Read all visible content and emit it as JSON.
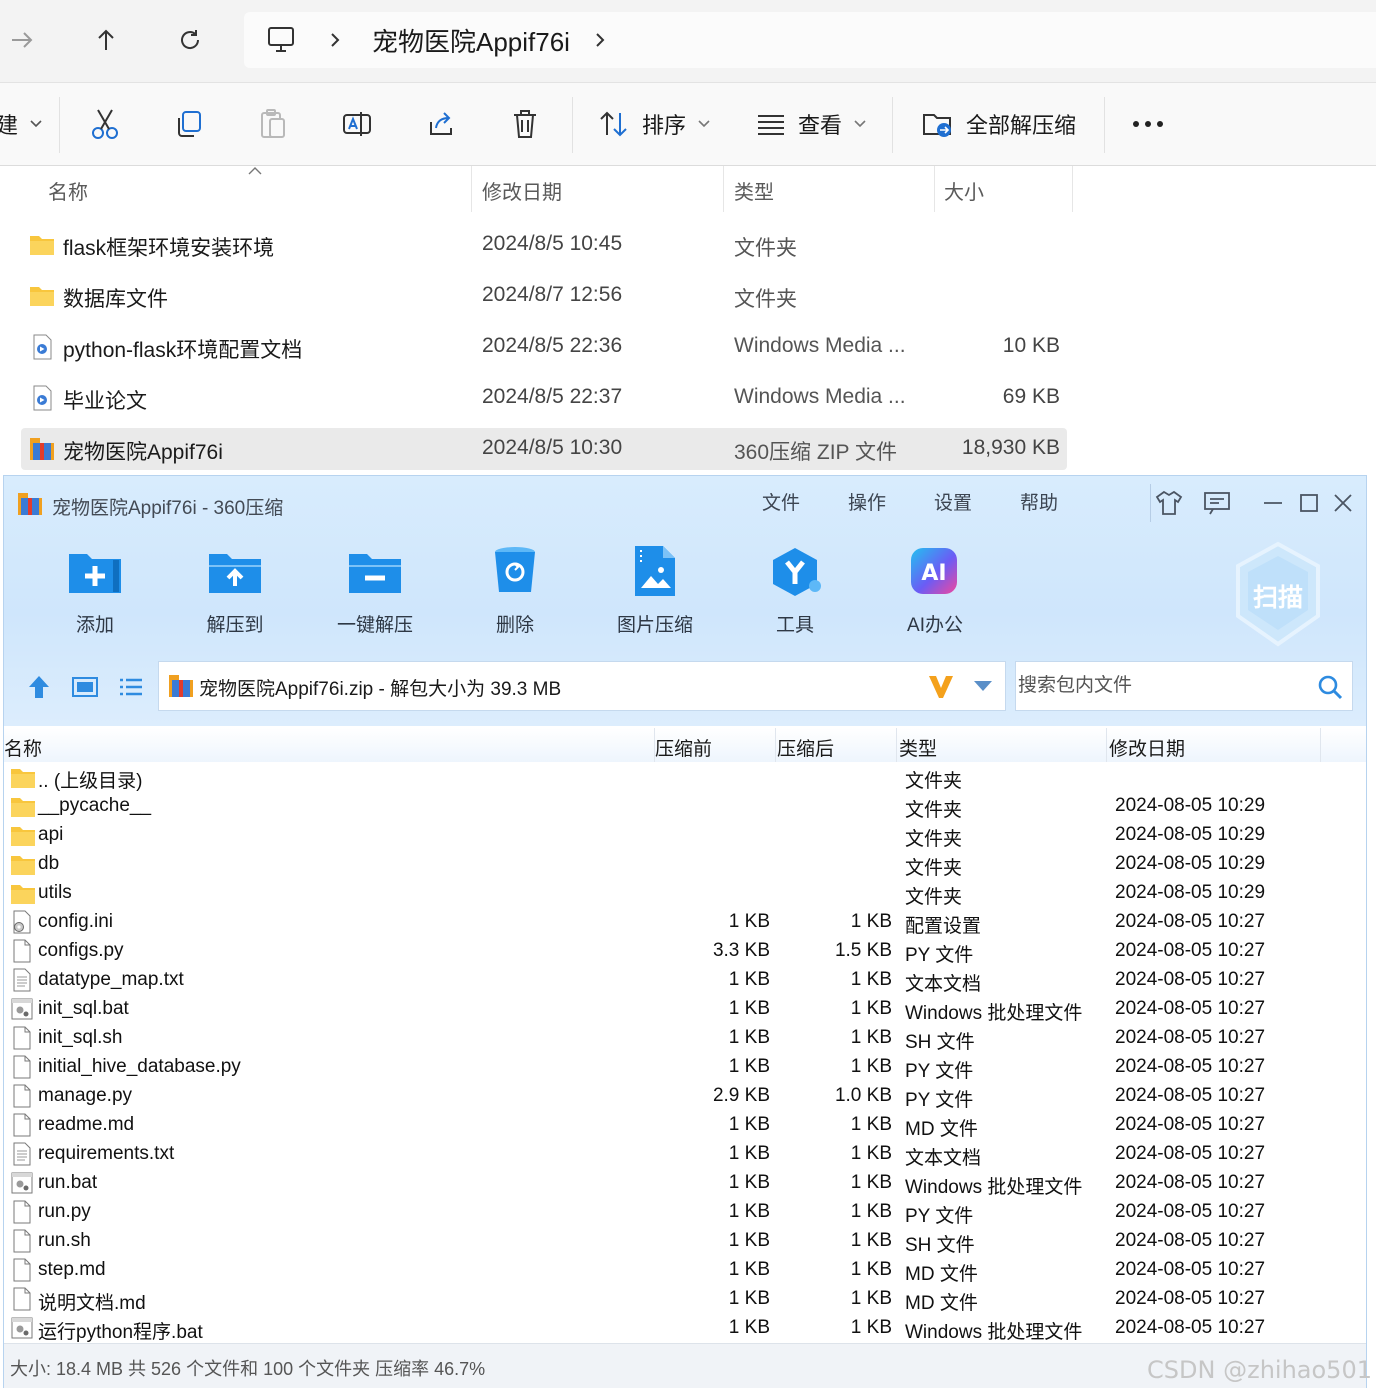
{
  "explorer": {
    "breadcrumb": "宠物医院Appif76i",
    "toolbar": {
      "new_partial": "建",
      "sort_label": "排序",
      "view_label": "查看",
      "extract_all_label": "全部解压缩"
    },
    "columns": {
      "name": "名称",
      "date": "修改日期",
      "type": "类型",
      "size": "大小"
    },
    "rows": [
      {
        "name": "flask框架环境安装环境",
        "date": "2024/8/5 10:45",
        "type": "文件夹",
        "size": "",
        "icon": "folder-icon"
      },
      {
        "name": "数据库文件",
        "date": "2024/8/7 12:56",
        "type": "文件夹",
        "size": "",
        "icon": "folder-icon"
      },
      {
        "name": "python-flask环境配置文档",
        "date": "2024/8/5 22:36",
        "type": "Windows Media ...",
        "size": "10 KB",
        "icon": "media-file-icon"
      },
      {
        "name": "毕业论文",
        "date": "2024/8/5 22:37",
        "type": "Windows Media ...",
        "size": "69 KB",
        "icon": "media-file-icon"
      },
      {
        "name": "宠物医院Appif76i",
        "date": "2024/8/5 10:30",
        "type": "360压缩 ZIP 文件",
        "size": "18,930 KB",
        "icon": "zip-archive-icon",
        "selected": true
      }
    ]
  },
  "archiver": {
    "title": "宠物医院Appif76i - 360压缩",
    "menu": [
      "文件",
      "操作",
      "设置",
      "帮助"
    ],
    "tools": [
      "添加",
      "解压到",
      "一键解压",
      "删除",
      "图片压缩",
      "工具",
      "AI办公"
    ],
    "scan_label": "扫描",
    "path": "宠物医院Appif76i.zip - 解包大小为 39.3 MB",
    "search_placeholder": "搜索包内文件",
    "columns": {
      "name": "名称",
      "before": "压缩前",
      "after": "压缩后",
      "type": "类型",
      "date": "修改日期"
    },
    "files": [
      {
        "name": ".. (上级目录)",
        "before": "",
        "after": "",
        "type": "文件夹",
        "date": "",
        "icon": "folder-icon"
      },
      {
        "name": "__pycache__",
        "before": "",
        "after": "",
        "type": "文件夹",
        "date": "2024-08-05 10:29",
        "icon": "folder-icon"
      },
      {
        "name": "api",
        "before": "",
        "after": "",
        "type": "文件夹",
        "date": "2024-08-05 10:29",
        "icon": "folder-icon"
      },
      {
        "name": "db",
        "before": "",
        "after": "",
        "type": "文件夹",
        "date": "2024-08-05 10:29",
        "icon": "folder-icon"
      },
      {
        "name": "utils",
        "before": "",
        "after": "",
        "type": "文件夹",
        "date": "2024-08-05 10:29",
        "icon": "folder-icon"
      },
      {
        "name": "config.ini",
        "before": "1 KB",
        "after": "1 KB",
        "type": "配置设置",
        "date": "2024-08-05 10:27",
        "icon": "settings-file-icon"
      },
      {
        "name": "configs.py",
        "before": "3.3 KB",
        "after": "1.5 KB",
        "type": "PY 文件",
        "date": "2024-08-05 10:27",
        "icon": "file-icon"
      },
      {
        "name": "datatype_map.txt",
        "before": "1 KB",
        "after": "1 KB",
        "type": "文本文档",
        "date": "2024-08-05 10:27",
        "icon": "text-file-icon"
      },
      {
        "name": "init_sql.bat",
        "before": "1 KB",
        "after": "1 KB",
        "type": "Windows 批处理文件",
        "date": "2024-08-05 10:27",
        "icon": "batch-file-icon"
      },
      {
        "name": "init_sql.sh",
        "before": "1 KB",
        "after": "1 KB",
        "type": "SH 文件",
        "date": "2024-08-05 10:27",
        "icon": "file-icon"
      },
      {
        "name": "initial_hive_database.py",
        "before": "1 KB",
        "after": "1 KB",
        "type": "PY 文件",
        "date": "2024-08-05 10:27",
        "icon": "file-icon"
      },
      {
        "name": "manage.py",
        "before": "2.9 KB",
        "after": "1.0 KB",
        "type": "PY 文件",
        "date": "2024-08-05 10:27",
        "icon": "file-icon"
      },
      {
        "name": "readme.md",
        "before": "1 KB",
        "after": "1 KB",
        "type": "MD 文件",
        "date": "2024-08-05 10:27",
        "icon": "file-icon"
      },
      {
        "name": "requirements.txt",
        "before": "1 KB",
        "after": "1 KB",
        "type": "文本文档",
        "date": "2024-08-05 10:27",
        "icon": "text-file-icon"
      },
      {
        "name": "run.bat",
        "before": "1 KB",
        "after": "1 KB",
        "type": "Windows 批处理文件",
        "date": "2024-08-05 10:27",
        "icon": "batch-file-icon"
      },
      {
        "name": "run.py",
        "before": "1 KB",
        "after": "1 KB",
        "type": "PY 文件",
        "date": "2024-08-05 10:27",
        "icon": "file-icon"
      },
      {
        "name": "run.sh",
        "before": "1 KB",
        "after": "1 KB",
        "type": "SH 文件",
        "date": "2024-08-05 10:27",
        "icon": "file-icon"
      },
      {
        "name": "step.md",
        "before": "1 KB",
        "after": "1 KB",
        "type": "MD 文件",
        "date": "2024-08-05 10:27",
        "icon": "file-icon"
      },
      {
        "name": "说明文档.md",
        "before": "1 KB",
        "after": "1 KB",
        "type": "MD 文件",
        "date": "2024-08-05 10:27",
        "icon": "file-icon"
      },
      {
        "name": "运行python程序.bat",
        "before": "1 KB",
        "after": "1 KB",
        "type": "Windows 批处理文件",
        "date": "2024-08-05 10:27",
        "icon": "batch-file-icon"
      }
    ],
    "status": "大小: 18.4 MB 共 526 个文件和 100 个文件夹 压缩率 46.7%"
  },
  "watermark": "CSDN @zhihao501",
  "colors": {
    "folder": "#f8c63d",
    "accent_blue": "#1e8ee9",
    "window_top": "#d8ecfd"
  }
}
